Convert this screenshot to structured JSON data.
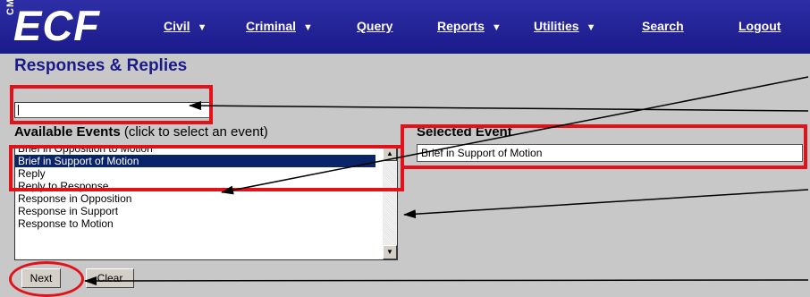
{
  "logo": {
    "main": "ECF",
    "prefix": "CM"
  },
  "nav": {
    "civil": "Civil",
    "criminal": "Criminal",
    "query": "Query",
    "reports": "Reports",
    "utilities": "Utilities",
    "search": "Search",
    "logout": "Logout"
  },
  "page": {
    "title": "Responses & Replies"
  },
  "event_search": {
    "value": ""
  },
  "available_events": {
    "label": "Available Events",
    "hint": "(click to select an event)",
    "items": [
      "Brief in Opposition to Motion",
      "Brief in Support of Motion",
      "Reply",
      "Reply to Response",
      "Response in Opposition",
      "Response in Support",
      "Response to Motion"
    ],
    "selected_index": 1
  },
  "selected_event": {
    "label": "Selected Event",
    "value": "Brief in Support of Motion"
  },
  "buttons": {
    "next": "Next",
    "clear": "Clear"
  },
  "colors": {
    "nav_background": "#1a1a8a",
    "page_background": "#c8c8c8",
    "highlight": "#e4101a",
    "list_selection": "#0a246a"
  }
}
